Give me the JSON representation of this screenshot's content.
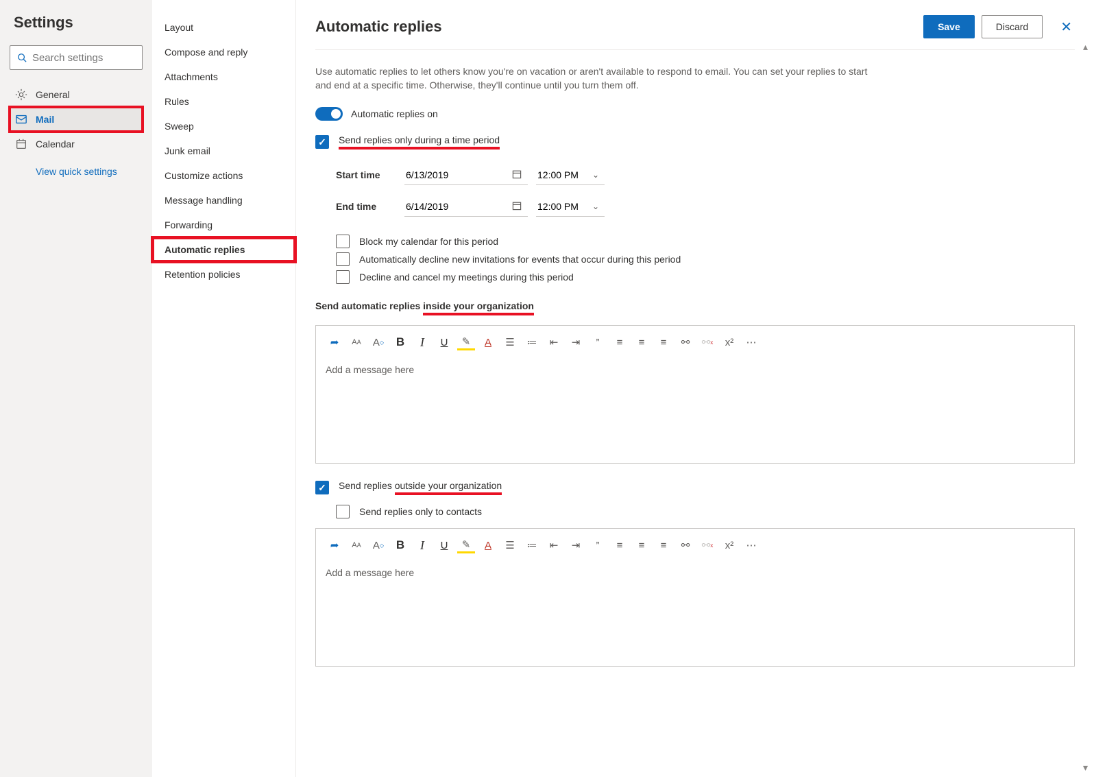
{
  "col1": {
    "title": "Settings",
    "search_placeholder": "Search settings",
    "categories": [
      {
        "key": "general",
        "label": "General"
      },
      {
        "key": "mail",
        "label": "Mail"
      },
      {
        "key": "calendar",
        "label": "Calendar"
      }
    ],
    "quick": "View quick settings"
  },
  "col2": {
    "items": [
      "Layout",
      "Compose and reply",
      "Attachments",
      "Rules",
      "Sweep",
      "Junk email",
      "Customize actions",
      "Message handling",
      "Forwarding",
      "Automatic replies",
      "Retention policies"
    ]
  },
  "header": {
    "title": "Automatic replies",
    "save": "Save",
    "discard": "Discard"
  },
  "body": {
    "description": "Use automatic replies to let others know you're on vacation or aren't available to respond to email. You can set your replies to start and end at a specific time. Otherwise, they'll continue until you turn them off.",
    "toggle_label": "Automatic replies on",
    "ck_period": "Send replies only during a time period",
    "start_label": "Start time",
    "start_date": "6/13/2019",
    "start_time": "12:00 PM",
    "end_label": "End time",
    "end_date": "6/14/2019",
    "end_time": "12:00 PM",
    "ck_block": "Block my calendar for this period",
    "ck_decline": "Automatically decline new invitations for events that occur during this period",
    "ck_cancel": "Decline and cancel my meetings during this period",
    "inside_head_a": "Send automatic replies ",
    "inside_head_b": "inside your organization",
    "editor_placeholder": "Add a message here",
    "ck_outside_a": "Send replies ",
    "ck_outside_b": "outside your organization",
    "ck_contacts": "Send replies only to contacts"
  }
}
